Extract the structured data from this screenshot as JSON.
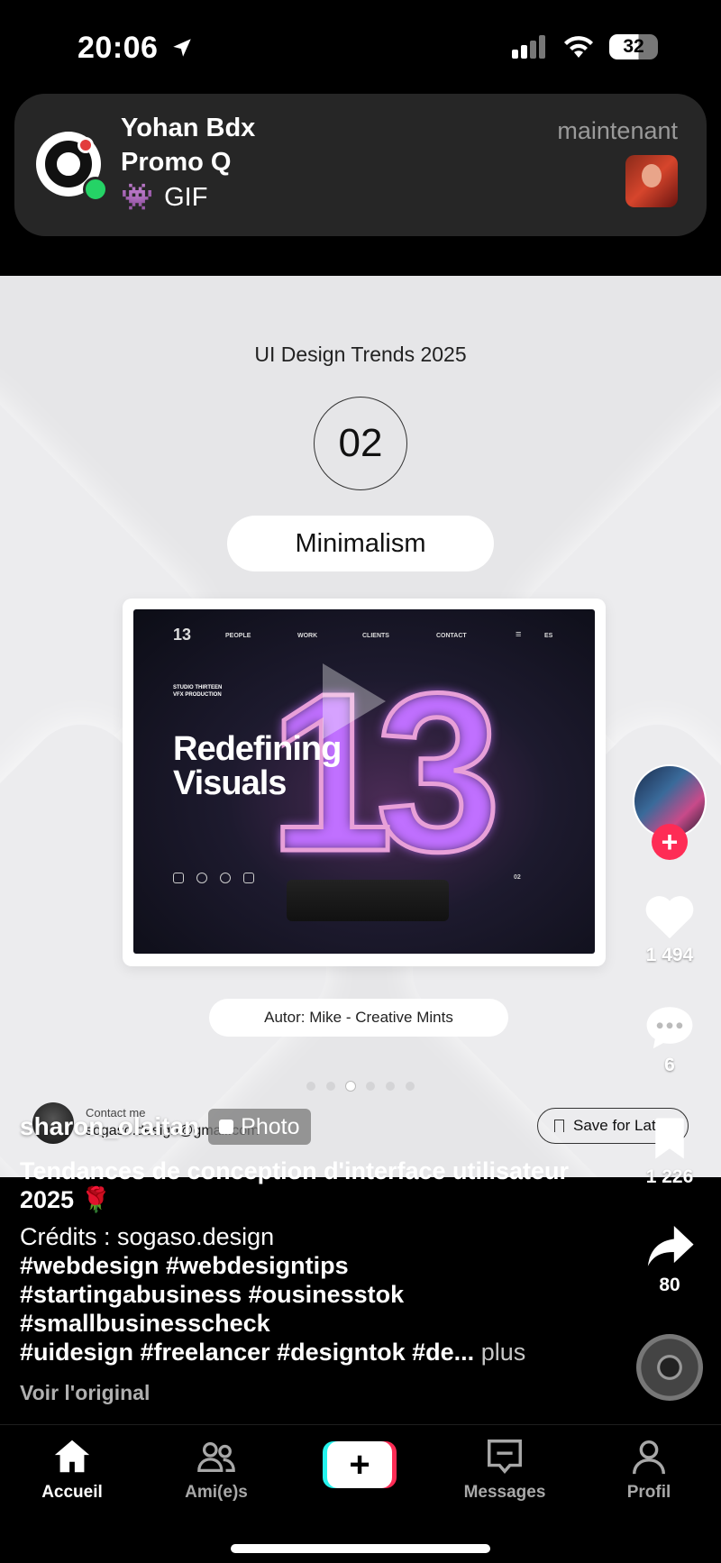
{
  "status_bar": {
    "time": "20:06",
    "battery": "32",
    "icons": [
      "location-arrow-icon",
      "cellular-signal-icon",
      "wifi-icon",
      "battery-icon"
    ]
  },
  "notification": {
    "sender": "Yohan Bdx",
    "group": "Promo Q",
    "body_emoji": "👾",
    "body": "GIF",
    "time": "maintenant"
  },
  "post": {
    "design_title": "UI Design Trends 2025",
    "number": "02",
    "topic": "Minimalism",
    "mockup": {
      "logo": "13",
      "nav": [
        "PEOPLE",
        "WORK",
        "CLIENTS",
        "CONTACT",
        "≡",
        "ES"
      ],
      "studio_line1": "STUDIO THIRTEEN",
      "studio_line2": "VFX PRODUCTION",
      "headline_line1": "Redefining",
      "headline_line2": "Visuals",
      "big_number": "13",
      "counter": "02"
    },
    "author": "Autor: Mike - Creative Mints",
    "carousel_pages": 6,
    "carousel_active_index": 2,
    "contact_label": "Contact me",
    "contact_email": "sogaso.design@gmail.com",
    "save_label": "Save for Later"
  },
  "rail": {
    "likes": "1 494",
    "comments": "6",
    "bookmarks": "1 226",
    "shares": "80",
    "follow_symbol": "+"
  },
  "caption": {
    "username": "sharon_olaitan",
    "badge": "Photo",
    "title": "Tendances de conception d'interface utilisateur 2025 🌹",
    "credits": "Crédits : sogaso.design",
    "tags_line1": "#webdesign #webdesigntips",
    "tags_line2": "#startingabusiness #ousinesstok",
    "tags_line3": "#smallbusinesscheck",
    "tags_line4": "#uidesign #freelancer #designtok #de...",
    "more": "plus",
    "translate": "Voir l'original"
  },
  "tabs": [
    {
      "label": "Accueil",
      "icon": "home-icon"
    },
    {
      "label": "Ami(e)s",
      "icon": "friends-icon"
    },
    {
      "label": "+",
      "icon": "create-icon"
    },
    {
      "label": "Messages",
      "icon": "messages-icon"
    },
    {
      "label": "Profil",
      "icon": "profile-icon"
    }
  ],
  "colors": {
    "accent_pink": "#fe2c55",
    "accent_cyan": "#25f4ee",
    "post_background": "#e6e6e8",
    "notification_bg": "#262626"
  }
}
